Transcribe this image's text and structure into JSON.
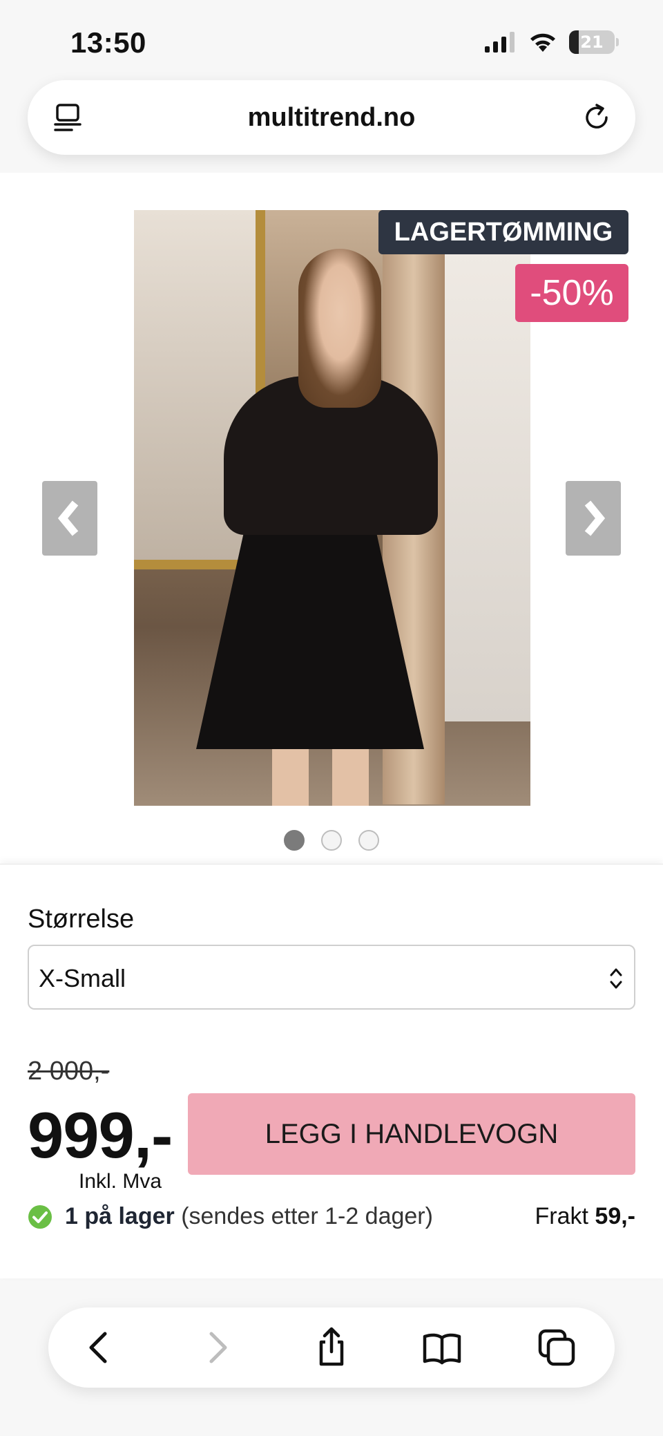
{
  "status_bar": {
    "time": "13:50",
    "battery_level": "21",
    "battery_fraction": 0.21
  },
  "browser": {
    "url": "multitrend.no"
  },
  "gallery": {
    "badge_clearance": "LAGERTØMMING",
    "badge_discount": "-50%",
    "image_count": 3,
    "active_image": 1,
    "colors": {
      "badge_clearance_bg": "#2e3542",
      "badge_discount_bg": "#e04d7c",
      "arrow_bg": "#b3b3b3"
    }
  },
  "product": {
    "size_label": "Størrelse",
    "size_selected": "X-Small",
    "old_price": "2 000,-",
    "price": "999,-",
    "vat_note": "Inkl. Mva",
    "cart_button": "LEGG I HANDLEVOGN",
    "stock_bold": "1 på lager",
    "stock_detail": "(sendes etter 1-2 dager)",
    "shipping_label": "Frakt",
    "shipping_price": "59,-",
    "colors": {
      "cart_button_bg": "#f0a9b6",
      "stock_check": "#6abf45"
    }
  },
  "toolbar": {
    "icons": [
      "back-icon",
      "forward-icon",
      "share-icon",
      "bookmarks-icon",
      "tabs-icon"
    ]
  }
}
